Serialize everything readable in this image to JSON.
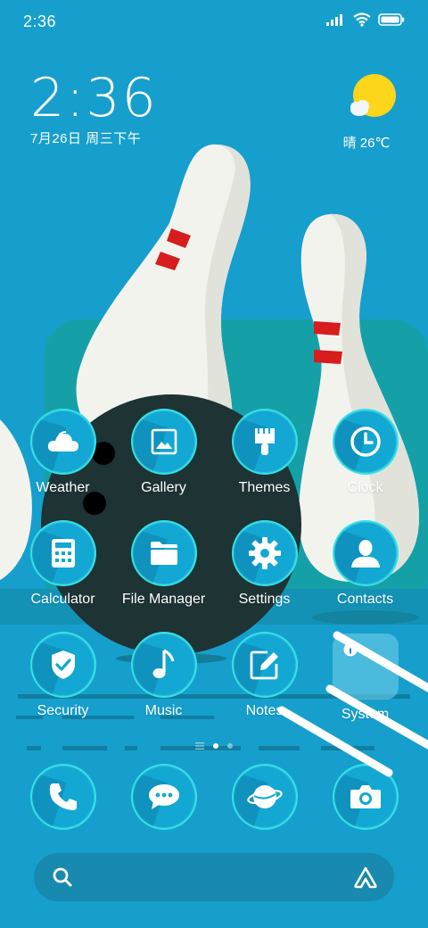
{
  "status_bar": {
    "time": "2:36",
    "icons": [
      "signal-icon",
      "wifi-icon",
      "battery-icon"
    ]
  },
  "clock_widget": {
    "time": "2:36",
    "date": "7月26日 周三下午"
  },
  "weather_widget": {
    "icon": "sun-cloud-icon",
    "text": "晴 26℃"
  },
  "apps": [
    {
      "label": "Weather",
      "icon": "weather-icon"
    },
    {
      "label": "Gallery",
      "icon": "gallery-icon"
    },
    {
      "label": "Themes",
      "icon": "paintbrush-icon"
    },
    {
      "label": "Clock",
      "icon": "clock-icon"
    },
    {
      "label": "Calculator",
      "icon": "calculator-icon"
    },
    {
      "label": "File Manager",
      "icon": "folder-icon"
    },
    {
      "label": "Settings",
      "icon": "gear-icon"
    },
    {
      "label": "Contacts",
      "icon": "person-icon"
    },
    {
      "label": "Security",
      "icon": "shield-icon"
    },
    {
      "label": "Music",
      "icon": "music-note-icon"
    },
    {
      "label": "Notes",
      "icon": "pencil-icon"
    },
    {
      "label": "System",
      "icon": "folder-icon"
    }
  ],
  "page_indicator": {
    "pages": 2,
    "current": 1
  },
  "dock": [
    {
      "icon": "phone-icon"
    },
    {
      "icon": "message-icon"
    },
    {
      "icon": "browser-icon"
    },
    {
      "icon": "camera-icon"
    }
  ],
  "search": {
    "search_icon": "search-icon",
    "assistant_icon": "assistant-icon"
  },
  "colors": {
    "background": "#169fcc",
    "icon_ring": "#2fe4e6",
    "ball": "#1e3333",
    "pin": "#f3f3ee",
    "pin_stripe": "#d71d1d"
  }
}
